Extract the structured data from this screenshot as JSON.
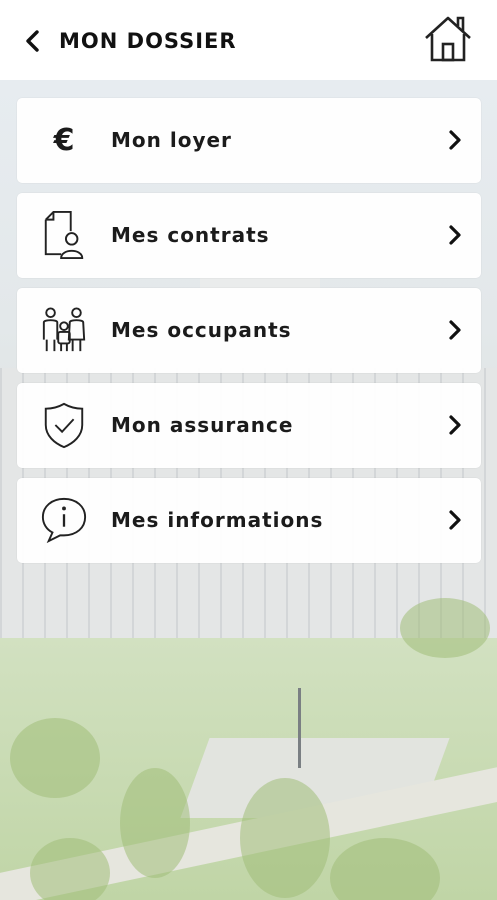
{
  "header": {
    "title": "MON DOSSIER"
  },
  "menu": {
    "items": [
      {
        "label": "Mon loyer",
        "icon": "euro-icon",
        "icon_text": "€"
      },
      {
        "label": "Mes contrats",
        "icon": "contract-document-icon"
      },
      {
        "label": "Mes occupants",
        "icon": "family-icon"
      },
      {
        "label": "Mon assurance",
        "icon": "shield-check-icon"
      },
      {
        "label": "Mes informations",
        "icon": "info-bubble-icon"
      }
    ]
  },
  "colors": {
    "text": "#1b1b1b",
    "header_bg": "#ffffff",
    "card_bg": "#ffffff"
  }
}
